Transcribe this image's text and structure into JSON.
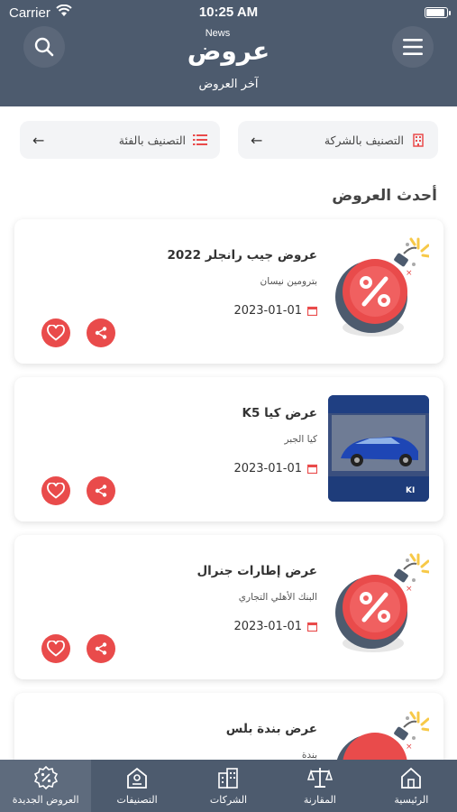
{
  "status_bar": {
    "carrier": "Carrier",
    "time": "10:25 AM"
  },
  "header": {
    "logo_small": "News",
    "logo_main": "عروض",
    "subtitle": "آخر العروض",
    "search_icon": "search-icon",
    "menu_icon": "hamburger-menu-icon"
  },
  "filters": {
    "by_company": "التصنيف بالشركة",
    "by_category": "التصنيف بالفئة"
  },
  "section_title": "أحدث العروض",
  "offers": [
    {
      "title": "عروض جيب رانجلر 2022",
      "company": "بترومين نيسان",
      "date": "2023-01-01",
      "image": "discount-bomb"
    },
    {
      "title": "عرض كيا K5",
      "company": "كيا الجبر",
      "date": "2023-01-01",
      "image": "car-photo"
    },
    {
      "title": "عرض إطارات جنرال",
      "company": "البنك الأهلي التجاري",
      "date": "2023-01-01",
      "image": "discount-bomb"
    },
    {
      "title": "عرض بندة بلس",
      "company": "بندة",
      "date": "",
      "image": "discount-bomb"
    }
  ],
  "bottom_nav": {
    "home": "الرئيسية",
    "compare": "المقارنة",
    "companies": "الشركات",
    "categories": "التصنيفات",
    "new_offers": "العروض الجديدة"
  },
  "colors": {
    "header_bg": "#4d5b6e",
    "accent_red": "#e94b4b"
  }
}
